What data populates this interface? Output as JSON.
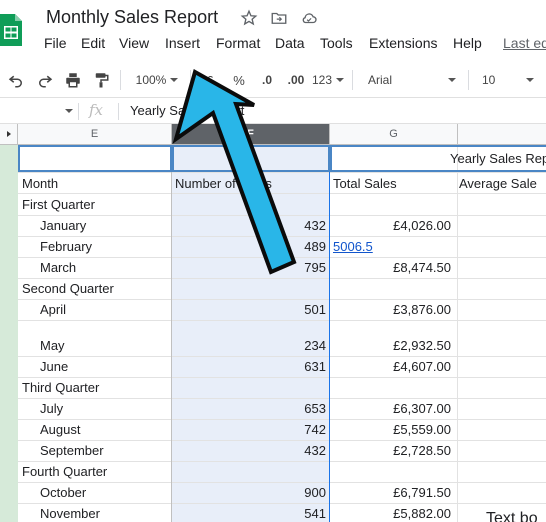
{
  "app": {
    "doc_title": "Monthly Sales Report",
    "brand_color": "#0f9d58"
  },
  "menu": {
    "items": [
      "File",
      "Edit",
      "View",
      "Insert",
      "Format",
      "Data",
      "Tools",
      "Extensions",
      "Help"
    ],
    "last_edit": "Last ed"
  },
  "toolbar": {
    "zoom": "100%",
    "currency": "£",
    "percent": "%",
    "decimal_less": ".0",
    "decimal_more": ".00",
    "more_formats": "123",
    "font": "Arial",
    "font_size": "10"
  },
  "formula_bar": {
    "fx": "fx",
    "value": "Yearly Sales Report"
  },
  "columns": {
    "E": "E",
    "F": "F",
    "G": "G"
  },
  "sheet": {
    "title_cell": "Yearly Sales Rep",
    "headers": {
      "month": "Month",
      "num_sales": "Number of Sales",
      "total_sales": "Total Sales",
      "avg_sale": "Average Sale"
    },
    "rows": [
      {
        "label": "First Quarter",
        "indent": false,
        "sales": "",
        "total": ""
      },
      {
        "label": "January",
        "indent": true,
        "sales": "432",
        "total": "£4,026.00"
      },
      {
        "label": "February",
        "indent": true,
        "sales": "489",
        "total": "5006.5"
      },
      {
        "label": "March",
        "indent": true,
        "sales": "795",
        "total": "£8,474.50"
      },
      {
        "label": "Second Quarter",
        "indent": false,
        "sales": "",
        "total": ""
      },
      {
        "label": "April",
        "indent": true,
        "sales": "501",
        "total": "£3,876.00"
      },
      {
        "label": "May",
        "indent": true,
        "sales": "234",
        "total": "£2,932.50"
      },
      {
        "label": "June",
        "indent": true,
        "sales": "631",
        "total": "£4,607.00"
      },
      {
        "label": "Third Quarter",
        "indent": false,
        "sales": "",
        "total": ""
      },
      {
        "label": "July",
        "indent": true,
        "sales": "653",
        "total": "£6,307.00"
      },
      {
        "label": "August",
        "indent": true,
        "sales": "742",
        "total": "£5,559.00"
      },
      {
        "label": "September",
        "indent": true,
        "sales": "432",
        "total": "£2,728.50"
      },
      {
        "label": "Fourth Quarter",
        "indent": false,
        "sales": "",
        "total": ""
      },
      {
        "label": "October",
        "indent": true,
        "sales": "900",
        "total": "£6,791.50"
      },
      {
        "label": "November",
        "indent": true,
        "sales": "541",
        "total": "£5,882.00"
      }
    ]
  },
  "overlay": {
    "text_box_label": "Text bo",
    "arrow_color": "#29b6e8"
  }
}
